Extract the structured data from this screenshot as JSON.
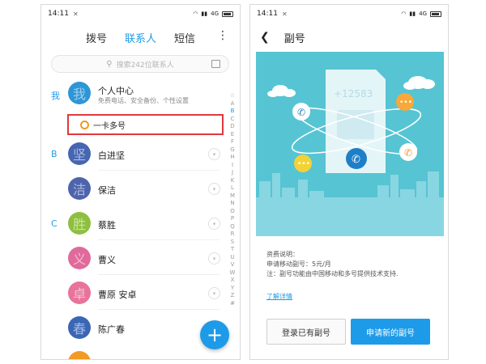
{
  "status": {
    "time": "14:11",
    "network": "4G"
  },
  "contacts_screen": {
    "tabs": [
      "拨号",
      "联系人",
      "短信"
    ],
    "search_placeholder": "搜索242位联系人",
    "me_letter": "我",
    "me": {
      "avatar_char": "我",
      "title": "个人中心",
      "subtitle": "免费电话、安全备份、个性设置",
      "color": "#2d96d7"
    },
    "multi_number": "一卡多号",
    "sections": [
      {
        "letter": "B",
        "contacts": [
          {
            "avatar_char": "坚",
            "name": "白进坚",
            "color": "#4766b2"
          },
          {
            "avatar_char": "洁",
            "name": "保洁",
            "color": "#4e64ad"
          }
        ]
      },
      {
        "letter": "C",
        "contacts": [
          {
            "avatar_char": "胜",
            "name": "蔡胜",
            "color": "#8fbf3f"
          },
          {
            "avatar_char": "义",
            "name": "曹义",
            "color": "#e06a9c"
          },
          {
            "avatar_char": "卓",
            "name": "曹原 安卓",
            "color": "#e8739b"
          },
          {
            "avatar_char": "春",
            "name": "陈广春",
            "color": "#3a66b5"
          }
        ]
      }
    ],
    "alphabet": [
      "☆",
      "A",
      "B",
      "C",
      "D",
      "E",
      "F",
      "G",
      "H",
      "I",
      "J",
      "K",
      "L",
      "M",
      "N",
      "O",
      "P",
      "Q",
      "R",
      "S",
      "T",
      "U",
      "V",
      "W",
      "X",
      "Y",
      "Z",
      "#"
    ],
    "alphabet_active": "B",
    "fab": "+"
  },
  "secondary_screen": {
    "title": "副号",
    "sim_number": "+12583",
    "fee_title": "资费说明：",
    "fee_line1": "申请移动副号：5元/月",
    "fee_line2": "注：副号功能由中国移动和多号提供技术支持.",
    "learn_more": "了解详情",
    "btn_login": "登录已有副号",
    "btn_apply": "申请新的副号"
  },
  "colors": {
    "accent": "#1e9be8",
    "hero_bg": "#56c4d3",
    "highlight": "#e0393e"
  }
}
